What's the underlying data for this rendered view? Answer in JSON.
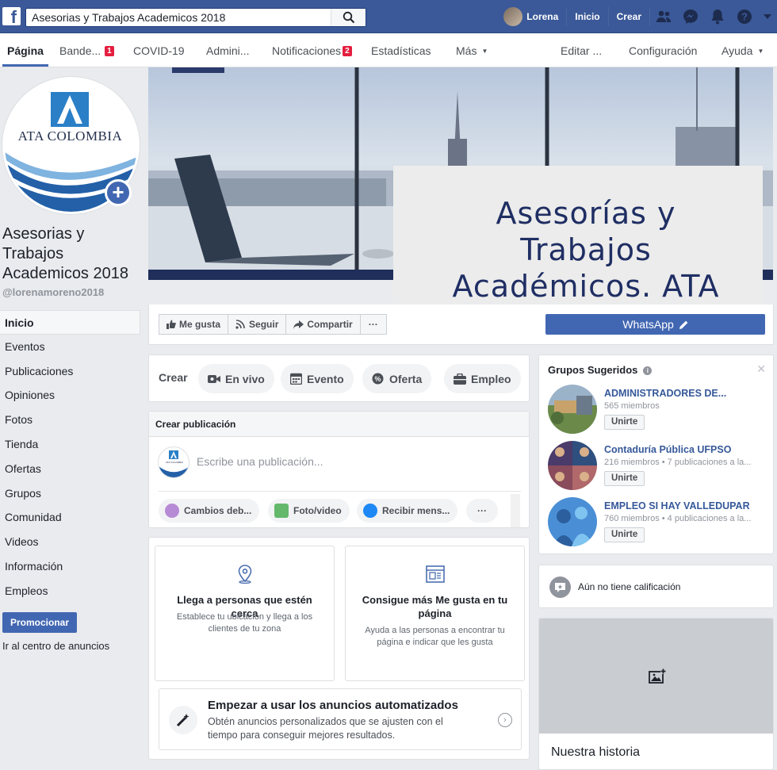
{
  "search": {
    "value": "Asesorias y Trabajos Academicos 2018"
  },
  "topbar": {
    "user": "Lorena",
    "home": "Inicio",
    "create": "Crear"
  },
  "tabs": [
    {
      "label": "Página"
    },
    {
      "label": "Bande...",
      "badge": "1"
    },
    {
      "label": "COVID-19"
    },
    {
      "label": "Admini..."
    },
    {
      "label": "Notificaciones",
      "badge": "2"
    },
    {
      "label": "Estadísticas"
    },
    {
      "label": "Más"
    },
    {
      "label": "Editar ..."
    },
    {
      "label": "Configuración"
    },
    {
      "label": "Ayuda"
    }
  ],
  "profile": {
    "logo_text": "ATA COLOMBIA",
    "name": "Asesorias y Trabajos Academicos 2018",
    "handle": "@lorenamoreno2018"
  },
  "nav": [
    "Inicio",
    "Eventos",
    "Publicaciones",
    "Opiniones",
    "Fotos",
    "Tienda",
    "Ofertas",
    "Grupos",
    "Comunidad",
    "Videos",
    "Información",
    "Empleos"
  ],
  "promote": {
    "button": "Promocionar",
    "ads_center": "Ir al centro de anuncios"
  },
  "cover": {
    "line1": "Asesorías y",
    "line2": "Trabajos",
    "line3": "Académicos. ATA"
  },
  "actions": {
    "like": "Me gusta",
    "follow": "Seguir",
    "share": "Compartir",
    "more": "···",
    "whatsapp": "WhatsApp"
  },
  "create": {
    "label": "Crear",
    "live": "En vivo",
    "event": "Evento",
    "offer": "Oferta",
    "job": "Empleo"
  },
  "post": {
    "header": "Crear publicación",
    "placeholder": "Escribe una publicación...",
    "avatar_text": "ATA COLOMBIA",
    "change": "Cambios deb...",
    "photo": "Foto/video",
    "messages": "Recibir mens...",
    "more": "···"
  },
  "tiles": [
    {
      "title": "Llega a personas que estén cerca",
      "desc": "Establece tu ubicación y llega a los clientes de tu zona"
    },
    {
      "title": "Consigue más Me gusta en tu página",
      "desc": "Ayuda a las personas a encontrar tu página e indicar que les gusta"
    }
  ],
  "auto_ads": {
    "title": "Empezar a usar los anuncios automatizados",
    "desc": "Obtén anuncios personalizados que se ajusten con el tiempo para conseguir mejores resultados."
  },
  "groups": {
    "title": "Grupos Sugeridos",
    "items": [
      {
        "name": "ADMINISTRADORES DE...",
        "meta": "565 miembros",
        "join": "Unirte"
      },
      {
        "name": "Contaduría Pública  UFPSO",
        "meta": "216 miembros • 7 publicaciones a la...",
        "join": "Unirte"
      },
      {
        "name": "EMPLEO SI HAY VALLEDUPAR",
        "meta": "760 miembros • 4 publicaciones a la...",
        "join": "Unirte"
      }
    ]
  },
  "rating": {
    "text": "Aún no tiene calificación"
  },
  "story": {
    "title": "Nuestra historia"
  },
  "colors": {
    "fb_blue": "#3b5998",
    "button_blue": "#4267b2",
    "badge_red": "#e41e3f",
    "brand_navy": "#1f2e63"
  }
}
